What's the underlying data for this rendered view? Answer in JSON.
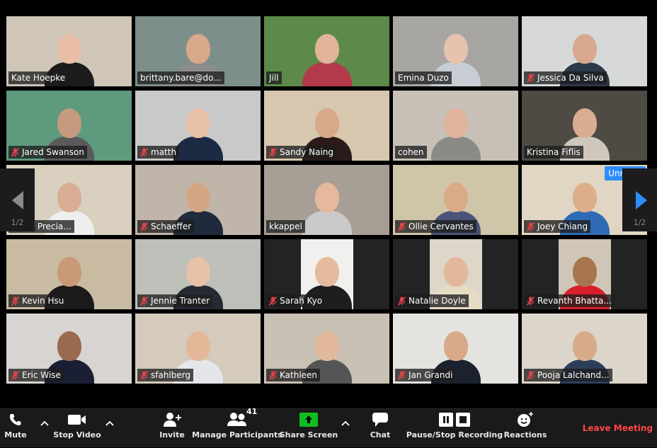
{
  "app": "Zoom Meeting - Gallery View",
  "colors": {
    "active_speaker_border": "#c4e25c",
    "accent_blue": "#2d8cff",
    "mute_red": "#e0424a",
    "leave_red": "#ff4545",
    "share_green": "#0ebe1f"
  },
  "gallery": {
    "page_indicator": "1/2",
    "active_speaker": "Kate Hoepke",
    "tiles": [
      {
        "name": "Kate Hoepke",
        "muted": false,
        "active": true,
        "bg": "#cfc6b8",
        "skin": "#e8bfa6",
        "shirt": "#1c1c1c"
      },
      {
        "name": "brittany.bare@do...",
        "muted": false,
        "bg": "#7d8f8a",
        "skin": "#d9a88a",
        "shirt": "#8c8c8c"
      },
      {
        "name": "Jill",
        "muted": false,
        "bg": "#5d8a4a",
        "skin": "#e2b49a",
        "shirt": "#b23a4b"
      },
      {
        "name": "Emina Duzo",
        "muted": false,
        "bg": "#a7a6a2",
        "skin": "#e6c3ae",
        "shirt": "#c8ccd4"
      },
      {
        "name": "Jessica Da Silva",
        "muted": true,
        "bg": "#d7d9d9",
        "skin": "#d8a98e",
        "shirt": "#2b3a4a"
      },
      {
        "name": "Jared Swanson",
        "muted": true,
        "bg": "#5e9a7e",
        "skin": "#c59a7e",
        "shirt": "#5a5a5a"
      },
      {
        "name": "matth",
        "muted": true,
        "bg": "#c9c9c9",
        "skin": "#e8c0a8",
        "shirt": "#1c2a44"
      },
      {
        "name": "Sandy Naing",
        "muted": true,
        "bg": "#d6c7ae",
        "skin": "#d8a888",
        "shirt": "#2a1a1a"
      },
      {
        "name": "cohen",
        "muted": false,
        "bg": "#c8c0b6",
        "skin": "#e0b49c",
        "shirt": "#8a8a86"
      },
      {
        "name": "Kristina Fiflis",
        "muted": false,
        "bg": "#4e4a44",
        "skin": "#d9ad92",
        "shirt": "#cfc7bc"
      },
      {
        "name": "alena Precia...",
        "muted": false,
        "bg": "#d9d0c0",
        "skin": "#d8ae94",
        "shirt": "#eeeeee"
      },
      {
        "name": "Schaeffer",
        "muted": true,
        "bg": "#bfb5a8",
        "skin": "#d5a686",
        "shirt": "#1f2a3c"
      },
      {
        "name": "kkappel",
        "muted": false,
        "bg": "#a79f96",
        "skin": "#e6b89c",
        "shirt": "#c9c9c9"
      },
      {
        "name": "Ollie Cervantes",
        "muted": true,
        "bg": "#cfc6aa",
        "skin": "#d9ab86",
        "shirt": "#4a5478"
      },
      {
        "name": "Joey Chiang",
        "muted": true,
        "bg": "#e1d6c4",
        "skin": "#dcae8a",
        "shirt": "#2f6bb5",
        "unmute_prompt": "Unmute"
      },
      {
        "name": "Kevin Hsu",
        "muted": true,
        "bg": "#c8bba2",
        "skin": "#c89a78",
        "shirt": "#1a1a1a"
      },
      {
        "name": "Jennie Tranter",
        "muted": true,
        "bg": "#bdbfb9",
        "skin": "#e7c2a8",
        "shirt": "#262a33"
      },
      {
        "name": "Sarah Kyo",
        "muted": true,
        "portrait": true,
        "bg": "#f0f0ee",
        "skin": "#e4bb9e",
        "shirt": "#1e1e1e"
      },
      {
        "name": "Natalie Doyle",
        "muted": true,
        "portrait": true,
        "bg": "#ded6c8",
        "skin": "#e2b89c",
        "shirt": "#e6dcc4"
      },
      {
        "name": "Revanth Bhatta...",
        "muted": true,
        "portrait": true,
        "bg": "#cfc6b8",
        "skin": "#a8764e",
        "shirt": "#d8202a"
      },
      {
        "name": "Eric Wise",
        "muted": true,
        "bg": "#d8d4d2",
        "skin": "#9a6a4e",
        "shirt": "#1a1f33"
      },
      {
        "name": "sfahlberg",
        "muted": true,
        "bg": "#d4cbbc",
        "skin": "#e2b898",
        "shirt": "#e4e6ea"
      },
      {
        "name": "Kathleen",
        "muted": true,
        "bg": "#c9c1b3",
        "skin": "#e2b89c",
        "shirt": "#555555"
      },
      {
        "name": "Jan Grandi",
        "muted": true,
        "bg": "#e5e3e0",
        "skin": "#d9a888",
        "shirt": "#1c2130"
      },
      {
        "name": "Pooja Lalchand...",
        "muted": true,
        "bg": "#dbd5ca",
        "skin": "#d8aa8a",
        "shirt": "#2c3e5a"
      }
    ]
  },
  "toolbar": {
    "mute": {
      "label": "Mute",
      "icon": "phone-icon"
    },
    "stop_video": {
      "label": "Stop Video",
      "icon": "video-camera-icon"
    },
    "invite": {
      "label": "Invite",
      "icon": "add-person-icon"
    },
    "manage_participants": {
      "label": "Manage Participants",
      "icon": "participants-icon",
      "count": "41"
    },
    "share_screen": {
      "label": "Share Screen",
      "icon": "share-arrow-icon"
    },
    "chat": {
      "label": "Chat",
      "icon": "chat-bubble-icon"
    },
    "recording": {
      "label": "Pause/Stop Recording",
      "icon": "pause-stop-icon"
    },
    "reactions": {
      "label": "Reactions",
      "icon": "smiley-plus-icon"
    },
    "leave": {
      "label": "Leave Meeting"
    }
  }
}
